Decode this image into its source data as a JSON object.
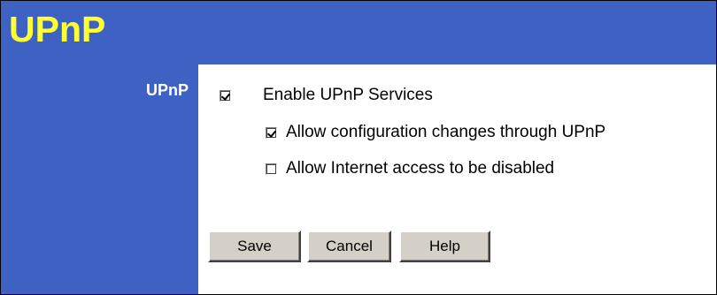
{
  "header": {
    "title": "UPnP"
  },
  "sidebar": {
    "section_label": "UPnP"
  },
  "options": {
    "enable_upnp": {
      "label": "Enable UPnP Services",
      "checked": true
    },
    "allow_config_changes": {
      "label": "Allow configuration changes through UPnP",
      "checked": true
    },
    "allow_internet_disable": {
      "label": "Allow Internet access to be disabled",
      "checked": false
    }
  },
  "buttons": {
    "save": "Save",
    "cancel": "Cancel",
    "help": "Help"
  },
  "colors": {
    "header_bg": "#3d62c4",
    "title_color": "#ffff33",
    "button_face": "#d4d0c8"
  }
}
